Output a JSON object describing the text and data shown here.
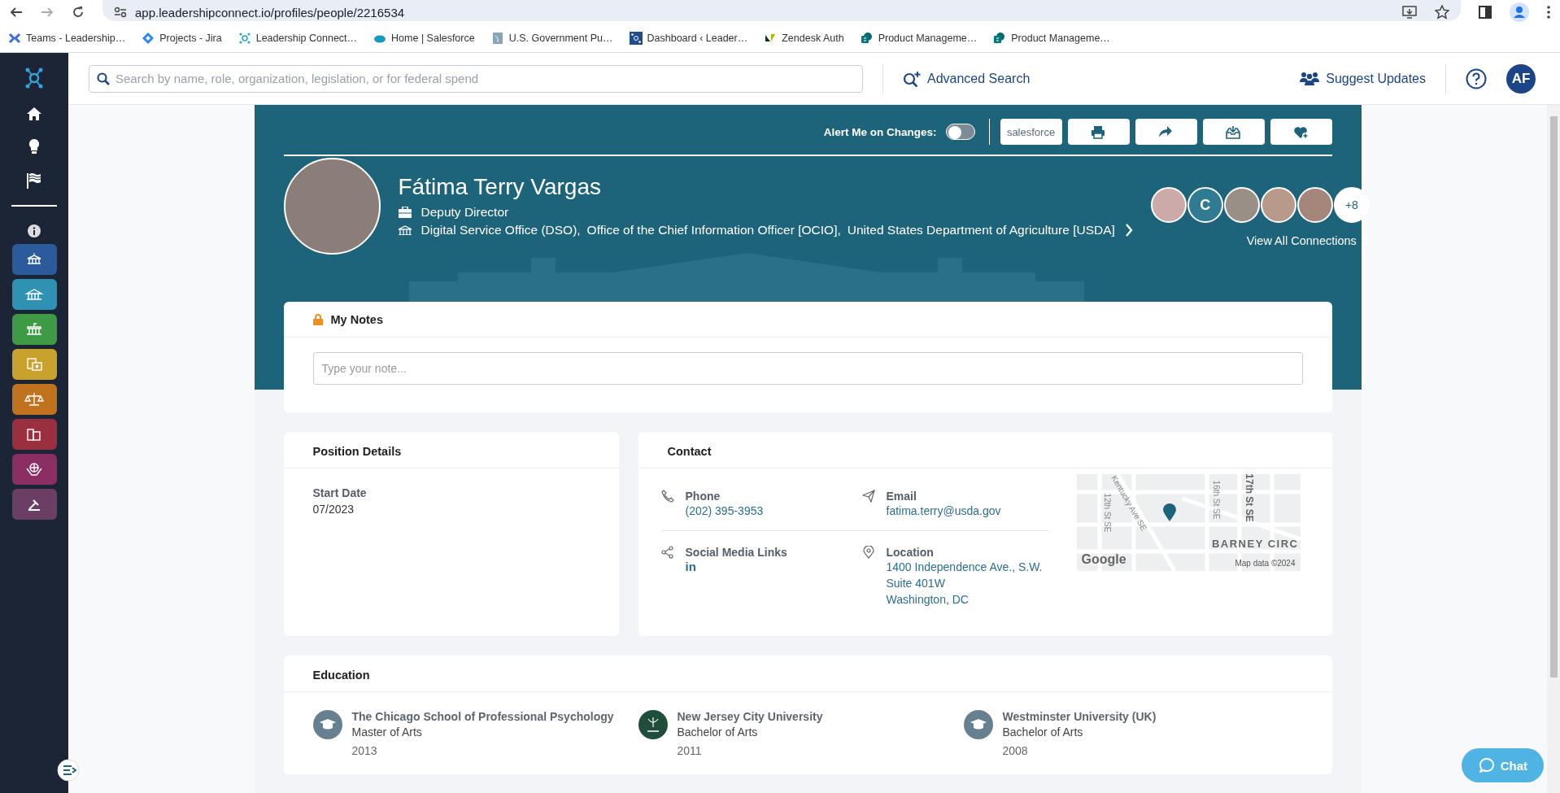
{
  "browser": {
    "url": "app.leadershipconnect.io/profiles/people/2216534",
    "bookmarks": [
      {
        "label": "Teams - Leadership…",
        "kind": "teams"
      },
      {
        "label": "Projects - Jira",
        "kind": "jira"
      },
      {
        "label": "Leadership Connect…",
        "kind": "hub"
      },
      {
        "label": "Home | Salesforce",
        "kind": "cloud"
      },
      {
        "label": "U.S. Government Pu…",
        "kind": "doc"
      },
      {
        "label": "Dashboard ‹ Leader…",
        "kind": "hub-dark"
      },
      {
        "label": "Zendesk Auth",
        "kind": "zendesk"
      },
      {
        "label": "Product Manageme…",
        "kind": "sharepoint"
      },
      {
        "label": "Product Manageme…",
        "kind": "sharepoint"
      }
    ]
  },
  "header": {
    "search_placeholder": "Search by name, role, organization, legislation, or for federal spend",
    "advanced_search": "Advanced Search",
    "suggest_updates": "Suggest Updates",
    "avatar_initials": "AF"
  },
  "profile": {
    "alert_label": "Alert Me on Changes:",
    "alert_on": false,
    "salesforce_label": "salesforce",
    "name": "Fátima Terry Vargas",
    "title": "Deputy Director",
    "organizations": [
      "Digital Service Office (DSO),",
      "Office of the Chief Information Officer [OCIO],",
      "United States Department of Agriculture [USDA]"
    ],
    "connection_initial": "C",
    "connections_more": "+8",
    "view_all": "View All Connections"
  },
  "notes": {
    "title": "My Notes",
    "placeholder": "Type your note..."
  },
  "position": {
    "title": "Position Details",
    "fields": [
      {
        "label": "Start Date",
        "value": "07/2023"
      }
    ]
  },
  "contact": {
    "title": "Contact",
    "items": [
      {
        "kind": "phone",
        "label": "Phone",
        "values": [
          "(202) 395-3953"
        ]
      },
      {
        "kind": "email",
        "label": "Email",
        "values": [
          "fatima.terry@usda.gov"
        ]
      },
      {
        "kind": "social",
        "label": "Social Media Links",
        "values": [
          "in"
        ]
      },
      {
        "kind": "location",
        "label": "Location",
        "values": [
          "1400 Independence Ave., S.W.",
          "Suite 401W",
          "Washington, DC"
        ]
      }
    ],
    "map": {
      "streets": [
        "12th St SE",
        "Kentucky Ave SE",
        "16th St SE",
        "17th St SE"
      ],
      "place": "BARNEY CIRC",
      "brand": "Google",
      "attribution": "Map data ©2024"
    }
  },
  "education": {
    "title": "Education",
    "items": [
      {
        "kind": "cap",
        "school": "The Chicago School of Professional Psychology",
        "degree": "Master of Arts",
        "year": "2013"
      },
      {
        "kind": "seal",
        "school": "New Jersey City University",
        "degree": "Bachelor of Arts",
        "year": "2011"
      },
      {
        "kind": "cap",
        "school": "Westminster University (UK)",
        "degree": "Bachelor of Arts",
        "year": "2008"
      }
    ]
  },
  "chat": {
    "label": "Chat"
  }
}
